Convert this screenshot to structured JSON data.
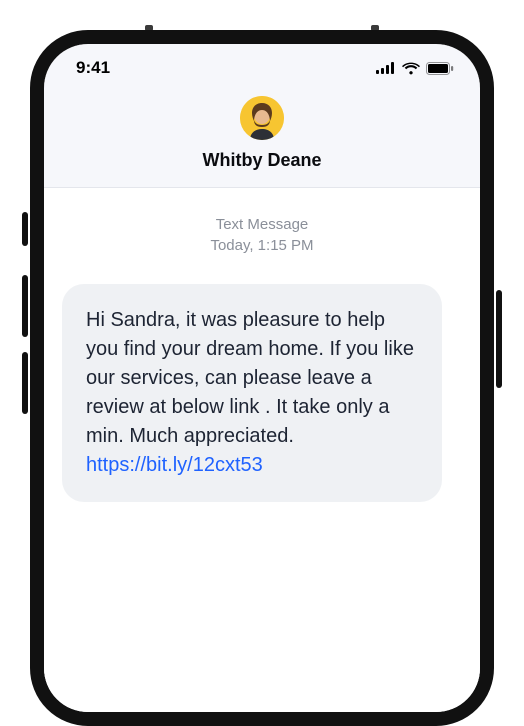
{
  "status": {
    "time": "9:41"
  },
  "header": {
    "contact_name": "Whitby Deane"
  },
  "thread": {
    "label": "Text Message",
    "timestamp": "Today, 1:15 PM",
    "message_text": "Hi Sandra, it was pleasure to help you find your dream home. If you like our services, can please leave a review at below link . It take only a min. Much appreciated.",
    "message_link": "https://bit.ly/12cxt53"
  }
}
